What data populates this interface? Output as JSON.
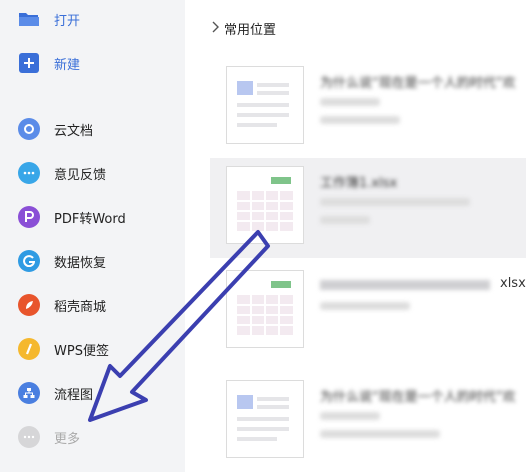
{
  "sidebar": {
    "items": [
      {
        "label": "打开",
        "icon": "folder-open-icon"
      },
      {
        "label": "新建",
        "icon": "new-plus-icon"
      },
      {
        "label": "云文档",
        "icon": "cloud-docs-icon"
      },
      {
        "label": "意见反馈",
        "icon": "feedback-icon"
      },
      {
        "label": "PDF转Word",
        "icon": "pdf-to-word-icon"
      },
      {
        "label": "数据恢复",
        "icon": "data-recovery-icon"
      },
      {
        "label": "稻壳商城",
        "icon": "docer-store-icon"
      },
      {
        "label": "WPS便签",
        "icon": "wps-notes-icon"
      },
      {
        "label": "流程图",
        "icon": "flowchart-icon"
      },
      {
        "label": "更多",
        "icon": "more-icon"
      }
    ]
  },
  "main": {
    "breadcrumb": "常用位置",
    "files": [
      {
        "name": "为什么说“现在是一个人的时代”欢",
        "type": "doc"
      },
      {
        "name": "工作簿1.xlsx",
        "type": "sheet"
      },
      {
        "name": "xlsx",
        "type": "sheet"
      },
      {
        "name": "为什么说“现在是一个人的时代”欢",
        "type": "doc"
      }
    ]
  },
  "colors": {
    "accent": "#3a6fd8",
    "sidebar_bg": "#f3f4f6",
    "selected_row": "#f0f0f2",
    "annotation_arrow": "#3b3fb0"
  }
}
